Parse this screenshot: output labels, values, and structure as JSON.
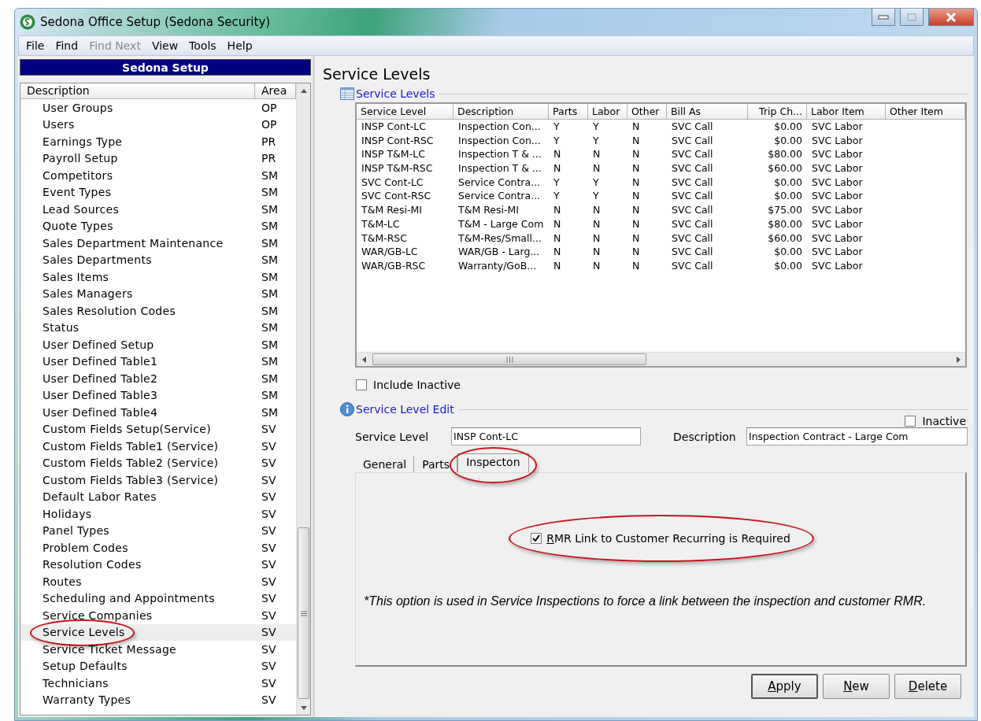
{
  "window": {
    "title": "Sedona Office Setup (Sedona Security)"
  },
  "menu": [
    {
      "label": "File",
      "disabled": false
    },
    {
      "label": "Find",
      "disabled": false
    },
    {
      "label": "Find Next",
      "disabled": true
    },
    {
      "label": "View",
      "disabled": false
    },
    {
      "label": "Tools",
      "disabled": false
    },
    {
      "label": "Help",
      "disabled": false
    }
  ],
  "sidebar": {
    "title": "Sedona Setup",
    "columns": [
      "Description",
      "Area"
    ],
    "items": [
      {
        "description": "User Groups",
        "area": "OP",
        "selected": false,
        "circled": false
      },
      {
        "description": "Users",
        "area": "OP",
        "selected": false,
        "circled": false
      },
      {
        "description": "Earnings Type",
        "area": "PR",
        "selected": false,
        "circled": false
      },
      {
        "description": "Payroll Setup",
        "area": "PR",
        "selected": false,
        "circled": false
      },
      {
        "description": "Competitors",
        "area": "SM",
        "selected": false,
        "circled": false
      },
      {
        "description": "Event Types",
        "area": "SM",
        "selected": false,
        "circled": false
      },
      {
        "description": "Lead Sources",
        "area": "SM",
        "selected": false,
        "circled": false
      },
      {
        "description": "Quote Types",
        "area": "SM",
        "selected": false,
        "circled": false
      },
      {
        "description": "Sales Department Maintenance",
        "area": "SM",
        "selected": false,
        "circled": false
      },
      {
        "description": "Sales Departments",
        "area": "SM",
        "selected": false,
        "circled": false
      },
      {
        "description": "Sales Items",
        "area": "SM",
        "selected": false,
        "circled": false
      },
      {
        "description": "Sales Managers",
        "area": "SM",
        "selected": false,
        "circled": false
      },
      {
        "description": "Sales Resolution Codes",
        "area": "SM",
        "selected": false,
        "circled": false
      },
      {
        "description": "Status",
        "area": "SM",
        "selected": false,
        "circled": false
      },
      {
        "description": "User Defined Setup",
        "area": "SM",
        "selected": false,
        "circled": false
      },
      {
        "description": "User Defined Table1",
        "area": "SM",
        "selected": false,
        "circled": false
      },
      {
        "description": "User Defined Table2",
        "area": "SM",
        "selected": false,
        "circled": false
      },
      {
        "description": "User Defined Table3",
        "area": "SM",
        "selected": false,
        "circled": false
      },
      {
        "description": "User Defined Table4",
        "area": "SM",
        "selected": false,
        "circled": false
      },
      {
        "description": "Custom Fields Setup(Service)",
        "area": "SV",
        "selected": false,
        "circled": false
      },
      {
        "description": "Custom Fields Table1 (Service)",
        "area": "SV",
        "selected": false,
        "circled": false
      },
      {
        "description": "Custom Fields Table2 (Service)",
        "area": "SV",
        "selected": false,
        "circled": false
      },
      {
        "description": "Custom Fields Table3 (Service)",
        "area": "SV",
        "selected": false,
        "circled": false
      },
      {
        "description": "Default Labor Rates",
        "area": "SV",
        "selected": false,
        "circled": false
      },
      {
        "description": "Holidays",
        "area": "SV",
        "selected": false,
        "circled": false
      },
      {
        "description": "Panel Types",
        "area": "SV",
        "selected": false,
        "circled": false
      },
      {
        "description": "Problem Codes",
        "area": "SV",
        "selected": false,
        "circled": false
      },
      {
        "description": "Resolution Codes",
        "area": "SV",
        "selected": false,
        "circled": false
      },
      {
        "description": "Routes",
        "area": "SV",
        "selected": false,
        "circled": false
      },
      {
        "description": "Scheduling and Appointments",
        "area": "SV",
        "selected": false,
        "circled": false
      },
      {
        "description": "Service Companies",
        "area": "SV",
        "selected": false,
        "circled": false
      },
      {
        "description": "Service Levels",
        "area": "SV",
        "selected": true,
        "circled": true
      },
      {
        "description": "Service Ticket Message",
        "area": "SV",
        "selected": false,
        "circled": false
      },
      {
        "description": "Setup Defaults",
        "area": "SV",
        "selected": false,
        "circled": false
      },
      {
        "description": "Technicians",
        "area": "SV",
        "selected": false,
        "circled": false
      },
      {
        "description": "Warranty Types",
        "area": "SV",
        "selected": false,
        "circled": false
      }
    ]
  },
  "page_title": "Service Levels",
  "list_group": {
    "title": "Service Levels",
    "table": {
      "columns": [
        "Service Level",
        "Description",
        "Parts",
        "Labor",
        "Other",
        "Bill As",
        "Trip Ch...",
        "Labor Item",
        "Other Item"
      ],
      "rows": [
        [
          "INSP Cont-LC",
          "Inspection Con...",
          "Y",
          "Y",
          "N",
          "SVC Call",
          "$0.00",
          "SVC Labor"
        ],
        [
          "INSP Cont-RSC",
          "Inspection Con...",
          "Y",
          "Y",
          "N",
          "SVC Call",
          "$0.00",
          "SVC Labor"
        ],
        [
          "INSP T&M-LC",
          "Inspection T & ...",
          "N",
          "N",
          "N",
          "SVC Call",
          "$80.00",
          "SVC Labor"
        ],
        [
          "INSP T&M-RSC",
          "Inspection T & ...",
          "N",
          "N",
          "N",
          "SVC Call",
          "$60.00",
          "SVC Labor"
        ],
        [
          "SVC Cont-LC",
          "Service Contra...",
          "Y",
          "Y",
          "N",
          "SVC Call",
          "$0.00",
          "SVC Labor"
        ],
        [
          "SVC Cont-RSC",
          "Service Contra...",
          "Y",
          "Y",
          "N",
          "SVC Call",
          "$0.00",
          "SVC Labor"
        ],
        [
          "T&M Resi-MI",
          "T&M Resi-MI",
          "N",
          "N",
          "N",
          "SVC Call",
          "$75.00",
          "SVC Labor"
        ],
        [
          "T&M-LC",
          "T&M - Large Com",
          "N",
          "N",
          "N",
          "SVC Call",
          "$80.00",
          "SVC Labor"
        ],
        [
          "T&M-RSC",
          "T&M-Res/Small...",
          "N",
          "N",
          "N",
          "SVC Call",
          "$60.00",
          "SVC Labor"
        ],
        [
          "WAR/GB-LC",
          "WAR/GB - Larg...",
          "N",
          "N",
          "N",
          "SVC Call",
          "$0.00",
          "SVC Labor"
        ],
        [
          "WAR/GB-RSC",
          "Warranty/GoB...",
          "N",
          "N",
          "N",
          "SVC Call",
          "$0.00",
          "SVC Labor"
        ]
      ]
    },
    "include_inactive": {
      "label": "Include Inactive",
      "checked": false
    }
  },
  "edit_group": {
    "title": "Service Level Edit",
    "inactive": {
      "label": "Inactive",
      "checked": false
    },
    "service_level": {
      "label": "Service Level",
      "value": "INSP Cont-LC"
    },
    "description": {
      "label": "Description",
      "value": "Inspection Contract - Large Com"
    },
    "tabs": [
      {
        "label": "General",
        "selected": false,
        "circled": false
      },
      {
        "label": "Parts",
        "selected": false,
        "circled": false
      },
      {
        "label": "Inspecton",
        "selected": true,
        "circled": true
      }
    ],
    "rmr_option": {
      "label": "RMR Link to Customer Recurring is Required",
      "checked": true,
      "circled": true
    },
    "note": "*This option is used in Service Inspections to force a link between the inspection and customer RMR."
  },
  "buttons": [
    {
      "label": "Apply",
      "default": true
    },
    {
      "label": "New",
      "default": false
    },
    {
      "label": "Delete",
      "default": false
    }
  ]
}
